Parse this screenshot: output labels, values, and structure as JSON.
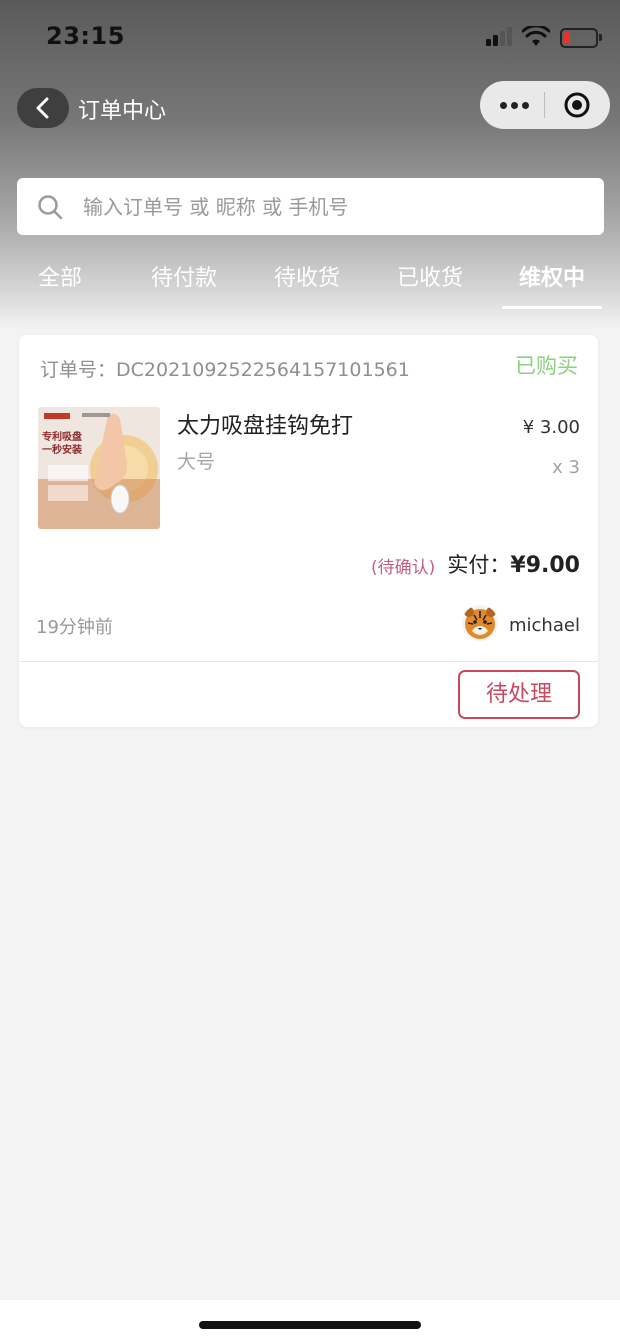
{
  "status_bar": {
    "time": "23:15"
  },
  "nav": {
    "title": "订单中心"
  },
  "search": {
    "placeholder": "输入订单号 或 昵称 或 手机号"
  },
  "tabs": [
    {
      "label": "全部"
    },
    {
      "label": "待付款"
    },
    {
      "label": "待收货"
    },
    {
      "label": "已收货"
    },
    {
      "label": "维权中",
      "active": true
    }
  ],
  "order": {
    "number_label": "订单号：DC2021092522564157101561",
    "status": "已购买",
    "product": {
      "thumbnail_text": "专利吸盘\n一秒安装",
      "name": "太力吸盘挂钩免打",
      "spec": "大号",
      "price": "¥ 3.00",
      "quantity": "x 3"
    },
    "confirm_status": "(待确认)",
    "paid_label": "实付：",
    "paid_amount": "¥9.00",
    "time_ago": "19分钟前",
    "user": {
      "name": "michael",
      "avatar_icon": "tiger-avatar"
    },
    "action_label": "待处理"
  },
  "colors": {
    "status_green": "#8fd07e",
    "accent_red": "#c8495f",
    "pending_pink": "#c46080"
  }
}
